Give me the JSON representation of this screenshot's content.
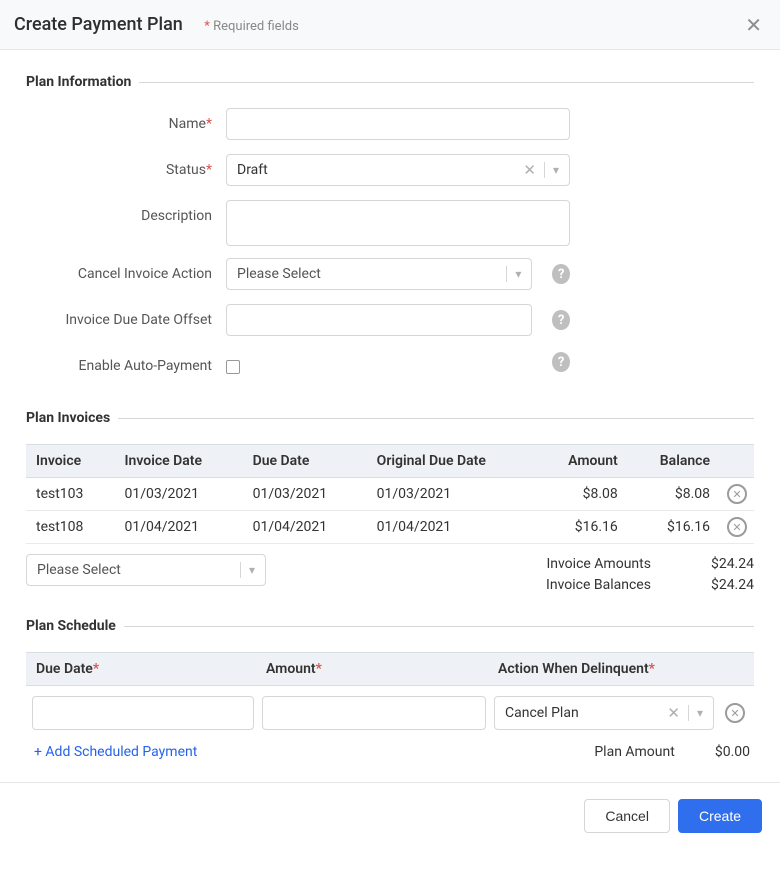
{
  "header": {
    "title": "Create Payment Plan",
    "required_note": "Required fields"
  },
  "sections": {
    "plan_info": "Plan Information",
    "plan_invoices": "Plan Invoices",
    "plan_schedule": "Plan Schedule"
  },
  "form": {
    "name": {
      "label": "Name",
      "value": ""
    },
    "status": {
      "label": "Status",
      "value": "Draft"
    },
    "description": {
      "label": "Description",
      "value": ""
    },
    "cancel_action": {
      "label": "Cancel Invoice Action",
      "placeholder": "Please Select"
    },
    "offset": {
      "label": "Invoice Due Date Offset",
      "value": ""
    },
    "autopay": {
      "label": "Enable Auto-Payment",
      "checked": false
    }
  },
  "invoices": {
    "headers": [
      "Invoice",
      "Invoice Date",
      "Due Date",
      "Original Due Date",
      "Amount",
      "Balance"
    ],
    "rows": [
      {
        "invoice": "test103",
        "invoice_date": "01/03/2021",
        "due_date": "01/03/2021",
        "orig_due_date": "01/03/2021",
        "amount": "$8.08",
        "balance": "$8.08"
      },
      {
        "invoice": "test108",
        "invoice_date": "01/04/2021",
        "due_date": "01/04/2021",
        "orig_due_date": "01/04/2021",
        "amount": "$16.16",
        "balance": "$16.16"
      }
    ],
    "add_placeholder": "Please Select",
    "totals": {
      "amounts_label": "Invoice Amounts",
      "amounts_value": "$24.24",
      "balances_label": "Invoice Balances",
      "balances_value": "$24.24"
    }
  },
  "schedule": {
    "headers": {
      "due_date": "Due Date",
      "amount": "Amount",
      "action": "Action When Delinquent"
    },
    "row": {
      "due_date": "",
      "amount": "",
      "action": "Cancel Plan"
    },
    "add_link": "+ Add Scheduled Payment",
    "plan_amount_label": "Plan Amount",
    "plan_amount_value": "$0.00"
  },
  "footer": {
    "cancel": "Cancel",
    "create": "Create"
  }
}
